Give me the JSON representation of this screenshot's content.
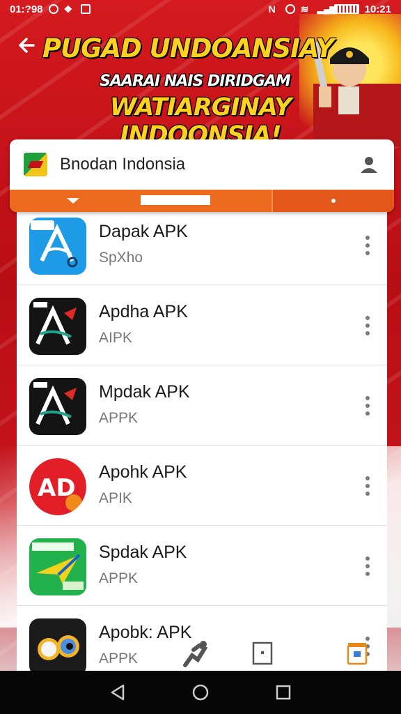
{
  "status_bar": {
    "time_left": "01:?98",
    "time_right": "10:21"
  },
  "header": {
    "title_line1": "PUGAD UNDOANSIAY",
    "title_line2": "SAARAI NAIS DIRIDGAM",
    "title_line3": "WATIARGINAY INDOONSIA!"
  },
  "search_card": {
    "title": "Bnodan Indonsia",
    "icons": [
      "app-logo",
      "user-icon"
    ]
  },
  "apps": [
    {
      "name": "Dapak APK",
      "sub": "SpXho",
      "icon": "blue-a-icon"
    },
    {
      "name": "Apdha APK",
      "sub": "AIPK",
      "icon": "black-a-rooster-icon"
    },
    {
      "name": "Mpdak APK",
      "sub": "APPK",
      "icon": "black-a-rooster-icon"
    },
    {
      "name": "Apohk APK",
      "sub": "APIK",
      "icon": "red-ad-icon"
    },
    {
      "name": "Spdak APK",
      "sub": "APPK",
      "icon": "green-plane-icon"
    },
    {
      "name": "Apobk: APK",
      "sub": "APPK",
      "icon": "glasses-character-icon"
    }
  ],
  "colors": {
    "primary_red": "#c8101a",
    "accent_orange": "#ec6a1e",
    "title_yellow": "#ffd21f"
  }
}
